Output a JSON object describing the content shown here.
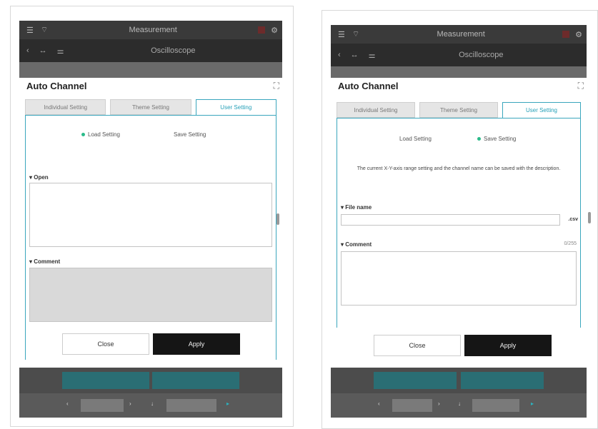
{
  "screens": [
    {
      "status_title": "Measurement",
      "window_title": "Oscilloscope",
      "dialog_title": "Auto Channel",
      "tabs": [
        "Individual Setting",
        "Theme Setting",
        "User Setting"
      ],
      "active_tab": 2,
      "radio": [
        {
          "label": "Load Setting",
          "selected": true
        },
        {
          "label": "Save Setting",
          "selected": false
        }
      ],
      "open_label": "Open",
      "comment_label": "Comment",
      "close_label": "Close",
      "apply_label": "Apply"
    },
    {
      "status_title": "Measurement",
      "window_title": "Oscilloscope",
      "dialog_title": "Auto Channel",
      "tabs": [
        "Individual Setting",
        "Theme Setting",
        "User Setting"
      ],
      "active_tab": 2,
      "radio": [
        {
          "label": "Load Setting",
          "selected": false
        },
        {
          "label": "Save Setting",
          "selected": true
        }
      ],
      "description": "The current X-Y-axis range setting and the channel name can be saved with the description.",
      "file_name_label": "File name",
      "file_name_value": "",
      "file_ext": ".csv",
      "comment_label": "Comment",
      "comment_count": "0/255",
      "close_label": "Close",
      "apply_label": "Apply"
    }
  ],
  "colors": {
    "accent": "#3aa6bd",
    "radio_selected": "#2bbb8a",
    "teal_button": "#2a6e74",
    "apply_bg": "#151515"
  }
}
